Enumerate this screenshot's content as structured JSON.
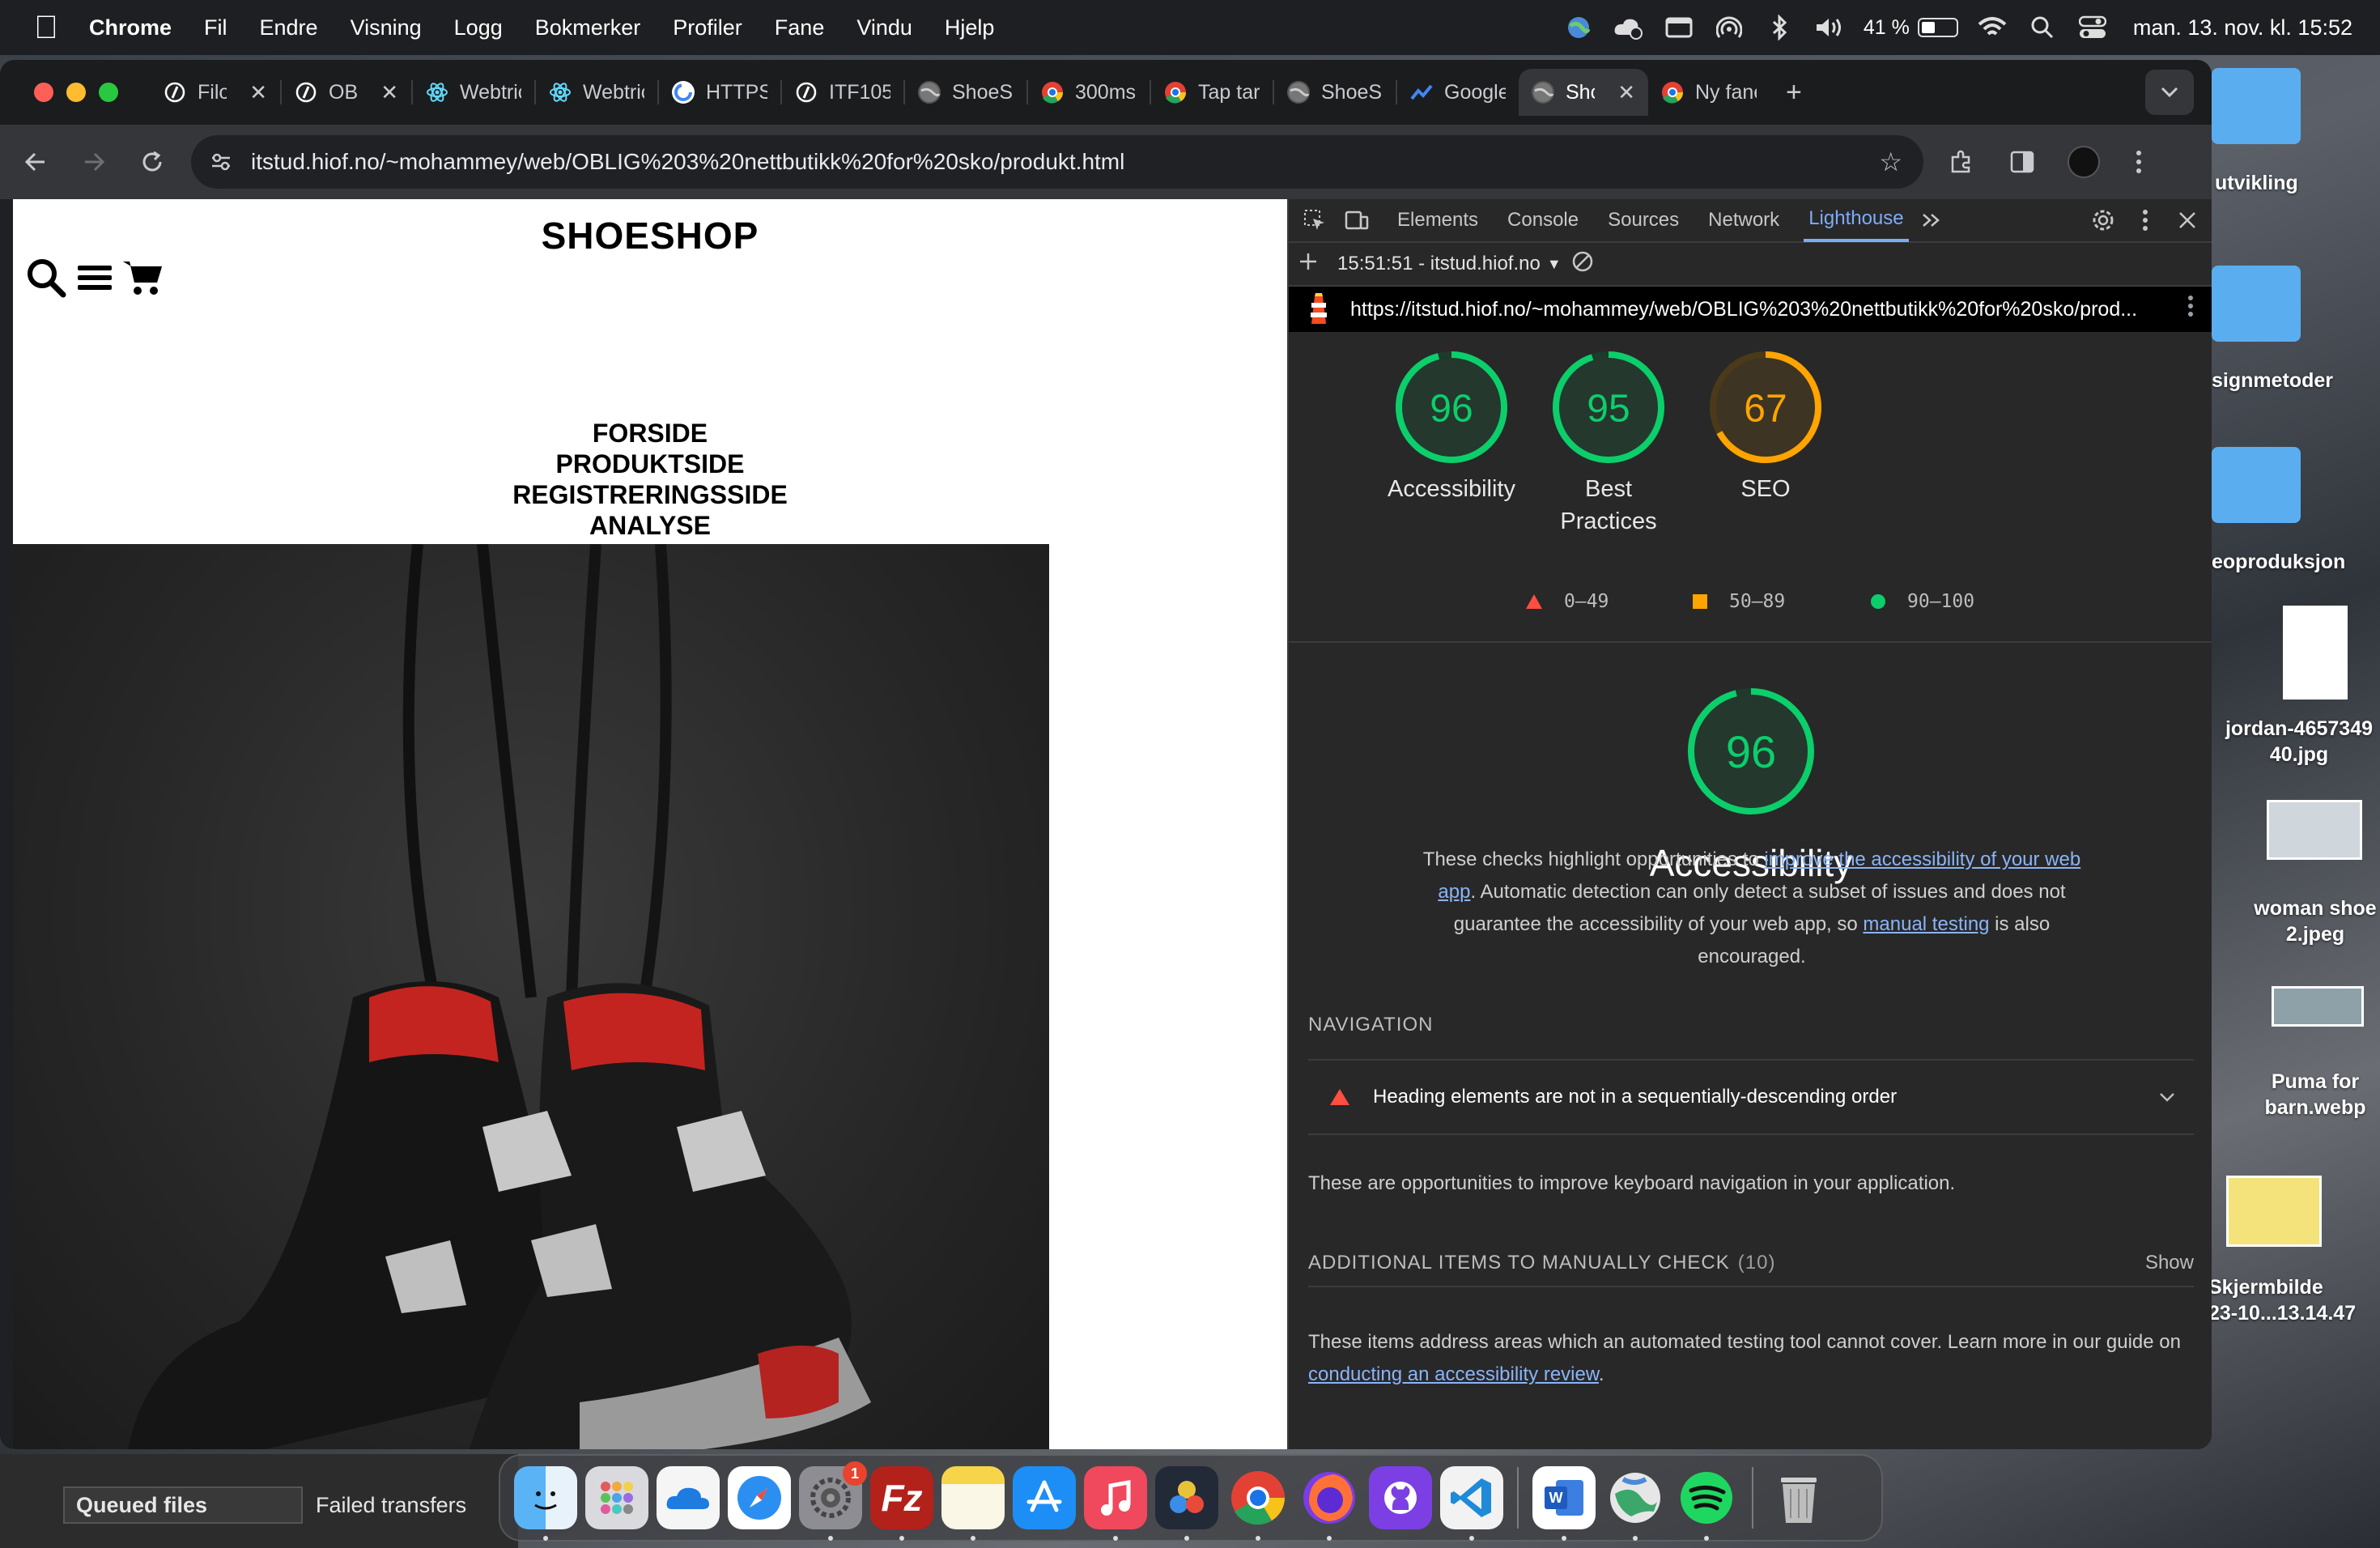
{
  "menubar": {
    "app": "Chrome",
    "items": [
      "Fil",
      "Endre",
      "Visning",
      "Logg",
      "Bokmerker",
      "Profiler",
      "Fane",
      "Vindu",
      "Hjelp"
    ],
    "battery_percent": "41 %",
    "battery_level": 0.41,
    "clock": "man. 13. nov. kl. 15:52"
  },
  "tabs": [
    {
      "label": "Filo",
      "icon": "logo-circle-icon",
      "closable": true
    },
    {
      "label": "OBI",
      "icon": "logo-circle-icon",
      "closable": true
    },
    {
      "label": "Webtric",
      "icon": "react-icon",
      "closable": false
    },
    {
      "label": "Webtric",
      "icon": "react-icon",
      "closable": false
    },
    {
      "label": "HTTPS",
      "icon": "google-icon",
      "closable": false
    },
    {
      "label": "ITF105",
      "icon": "logo-circle-icon",
      "closable": false
    },
    {
      "label": "ShoeSh",
      "icon": "globe-icon",
      "closable": false
    },
    {
      "label": "300ms",
      "icon": "chrome-icon",
      "closable": false
    },
    {
      "label": "Tap tar",
      "icon": "chrome-icon",
      "closable": false
    },
    {
      "label": "ShoeSh",
      "icon": "globe-icon",
      "closable": false
    },
    {
      "label": "Google",
      "icon": "trend-icon",
      "closable": false
    },
    {
      "label": "Shc",
      "icon": "globe-icon",
      "closable": true,
      "active": true
    },
    {
      "label": "Ny fane",
      "icon": "chrome-icon",
      "closable": false
    }
  ],
  "omnibox": {
    "url": "itstud.hiof.no/~mohammey/web/OBLIG%203%20nettbutikk%20for%20sko/produkt.html"
  },
  "site": {
    "title": "SHOESHOP",
    "nav": [
      "FORSIDE",
      "PRODUKTSIDE",
      "REGISTRERINGSSIDE",
      "ANALYSE"
    ]
  },
  "devtools": {
    "tabs": [
      "Elements",
      "Console",
      "Sources",
      "Network",
      "Lighthouse"
    ],
    "active_tab": "Lighthouse",
    "report_time": "15:51:51 - itstud.hiof.no",
    "report_url": "https://itstud.hiof.no/~mohammey/web/OBLIG%203%20nettbutikk%20for%20sko/prod...",
    "scores": [
      {
        "label": "Accessibility",
        "value": 96,
        "color": "#0cce6b"
      },
      {
        "label": "Best\nPractices",
        "value": 95,
        "color": "#0cce6b"
      },
      {
        "label": "SEO",
        "value": 67,
        "color": "#ffa400"
      }
    ],
    "legend": [
      {
        "range": "0–49",
        "shape": "triangle",
        "color": "#ff4e42"
      },
      {
        "range": "50–89",
        "shape": "square",
        "color": "#ffa400"
      },
      {
        "range": "90–100",
        "shape": "circle",
        "color": "#0cce6b"
      }
    ],
    "category": {
      "score": 96,
      "title": "Accessibility",
      "desc_1": "These checks highlight opportunities to ",
      "desc_link_1": "improve the accessibility of your web app",
      "desc_2": ". Automatic detection can only detect a subset of issues and does not guarantee the accessibility of your web app, so ",
      "desc_link_2": "manual testing",
      "desc_3": " is also encouraged."
    },
    "navigation_heading": "NAVIGATION",
    "audit_item": "Heading elements are not in a sequentially-descending order",
    "navigation_text": "These are opportunities to improve keyboard navigation in your application.",
    "manual_heading": "ADDITIONAL ITEMS TO MANUALLY CHECK",
    "manual_count": "(10)",
    "manual_show": "Show",
    "manual_text": "These items address areas which an automated testing tool cannot cover. Learn more in our guide on ",
    "manual_link": "conducting an accessibility review",
    "manual_end": "."
  },
  "desktop": {
    "folders": [
      "utvikling",
      "signmetoder",
      "eoproduksjon"
    ],
    "files": [
      {
        "name": "jordan-4657349\n40.jpg"
      },
      {
        "name": "woman shoe\n2.jpeg"
      },
      {
        "name": "Puma for\nbarn.webp"
      },
      {
        "name": "Skjermbilde\n23-10...13.14.47"
      }
    ]
  },
  "filezilla": {
    "tabs": [
      "Queued files",
      "Failed transfers"
    ]
  },
  "dock": {
    "apps": [
      "finder-icon",
      "launchpad-icon",
      "onedrive-icon",
      "safari-icon",
      "system-settings-icon",
      "filezilla-icon",
      "notes-icon",
      "app-store-icon",
      "music-icon",
      "davinci-icon",
      "chrome-icon",
      "firefox-icon",
      "github-desktop-icon",
      "vscode-icon",
      "word-icon",
      "globe-app-icon",
      "spotify-icon",
      "trash-icon"
    ],
    "settings_badge": "1"
  }
}
